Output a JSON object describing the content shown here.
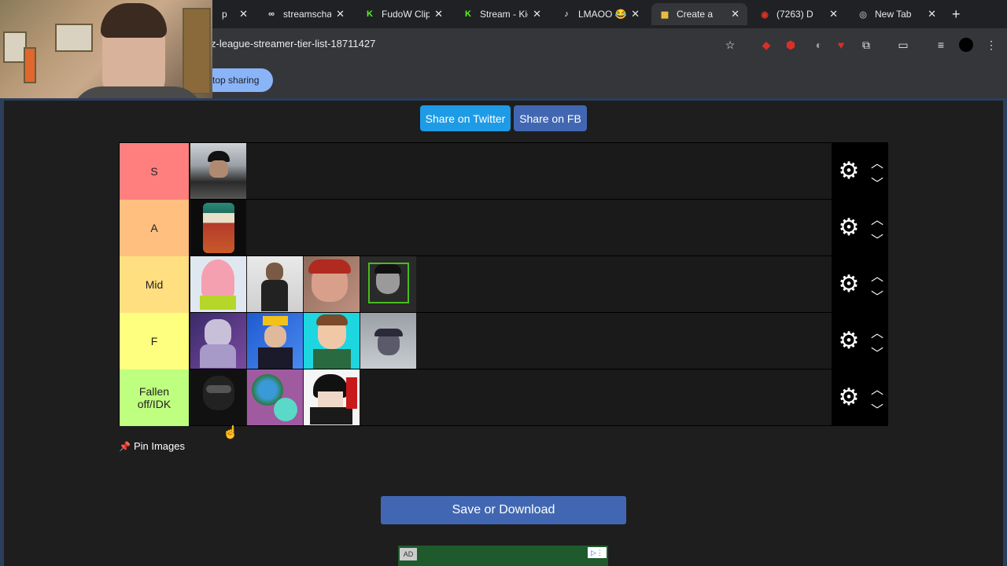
{
  "browser": {
    "tabs": [
      {
        "title": "p",
        "icon": "generic-tab-icon",
        "color": "#9aa0a6",
        "active": false
      },
      {
        "title": "streamschar",
        "icon": "streamscharts-icon",
        "color": "#e8eaed",
        "active": false
      },
      {
        "title": "FudoW Clips",
        "icon": "kick-icon",
        "color": "#53fc18",
        "active": false
      },
      {
        "title": "Stream - Kic",
        "icon": "kick-icon",
        "color": "#53fc18",
        "active": false
      },
      {
        "title": "LMAOO 😂",
        "icon": "tiktok-icon",
        "color": "#ffffff",
        "active": false
      },
      {
        "title": "Create a",
        "icon": "tiermaker-icon",
        "color": "#f7c948",
        "active": true
      },
      {
        "title": "(7263) D",
        "icon": "dlive-icon",
        "color": "#d93025",
        "active": false
      },
      {
        "title": "New Tab",
        "icon": "chrome-icon",
        "color": "#9aa0a6",
        "active": false
      }
    ],
    "url": "z-league-streamer-tier-list-18711427",
    "stop_sharing_label": "top sharing"
  },
  "share": {
    "twitter_label": "Share on Twitter",
    "fb_label": "Share on FB"
  },
  "tiers": [
    {
      "label": "S",
      "color": "#ff7f7f",
      "items": [
        "streamer-beanie-photo"
      ]
    },
    {
      "label": "A",
      "color": "#ffbf7f",
      "items": [
        "heinz-beans-can"
      ]
    },
    {
      "label": "Mid",
      "color": "#ffdf7f",
      "items": [
        "patrick-star",
        "man-with-microphone",
        "man-in-car",
        "man-bw-photo"
      ]
    },
    {
      "label": "F",
      "color": "#ffff7f",
      "items": [
        "man-drinking-purple",
        "man-with-crown",
        "smiling-boy",
        "man-in-cap-bw"
      ]
    },
    {
      "label": "Fallen off/IDK",
      "color": "#bfff7f",
      "items": [
        "masked-figure",
        "earth-cartoon",
        "anime-joker"
      ]
    }
  ],
  "pin_images_label": "Pin Images",
  "save_label": "Save or Download",
  "ad_badge": "AD"
}
